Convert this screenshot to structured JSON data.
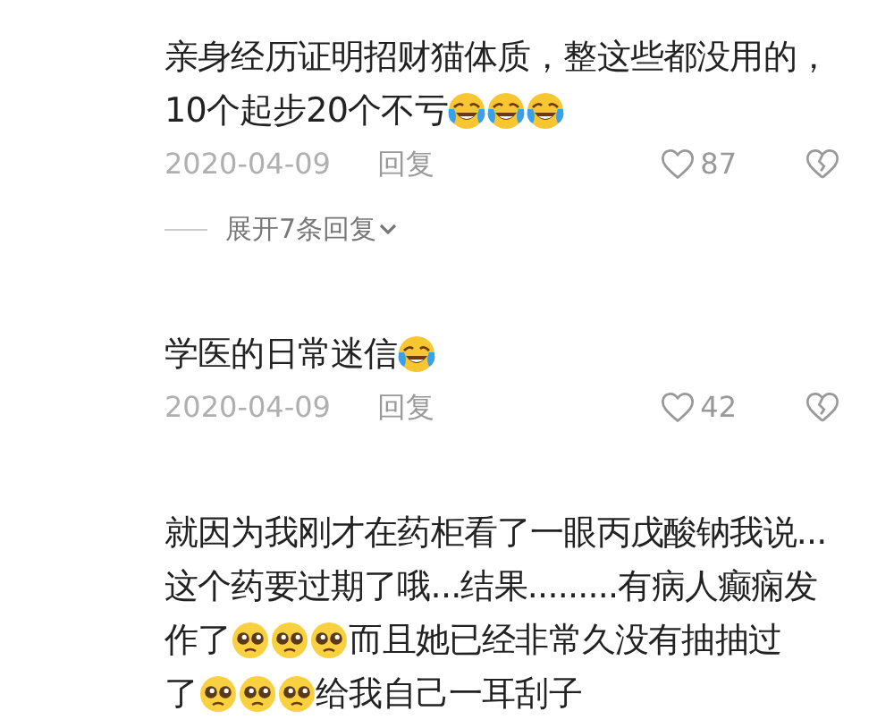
{
  "comments": [
    {
      "lines": [
        [
          {
            "kind": "text",
            "text": "亲身经历证明招财猫体质，整这些都没用的，"
          }
        ],
        [
          {
            "kind": "text",
            "text": "10个起步20个不亏"
          },
          {
            "kind": "laughing-emoji"
          },
          {
            "kind": "laughing-emoji"
          },
          {
            "kind": "laughing-emoji"
          }
        ]
      ],
      "date": "2020-04-09",
      "reply": "回复",
      "likes": "87",
      "liked": false,
      "expand": "展开7条回复"
    },
    {
      "lines": [
        [
          {
            "kind": "text",
            "text": "学医的日常迷信"
          },
          {
            "kind": "laughing-emoji"
          }
        ]
      ],
      "date": "2020-04-09",
      "reply": "回复",
      "likes": "42",
      "liked": false
    },
    {
      "lines": [
        [
          {
            "kind": "text",
            "text": "就因为我刚才在药柜看了一眼丙戊酸钠我说..."
          }
        ],
        [
          {
            "kind": "text",
            "text": "这个药要过期了哦...结果.........有病人癫痫发"
          }
        ],
        [
          {
            "kind": "text",
            "text": "作了"
          },
          {
            "kind": "pleading-emoji"
          },
          {
            "kind": "pleading-emoji"
          },
          {
            "kind": "pleading-emoji"
          },
          {
            "kind": "text",
            "text": "而且她已经非常久没有抽抽过"
          }
        ],
        [
          {
            "kind": "text",
            "text": "了"
          },
          {
            "kind": "pleading-emoji"
          },
          {
            "kind": "pleading-emoji"
          },
          {
            "kind": "pleading-emoji"
          },
          {
            "kind": "text",
            "text": "给我自己一耳刮子"
          }
        ]
      ]
    }
  ]
}
